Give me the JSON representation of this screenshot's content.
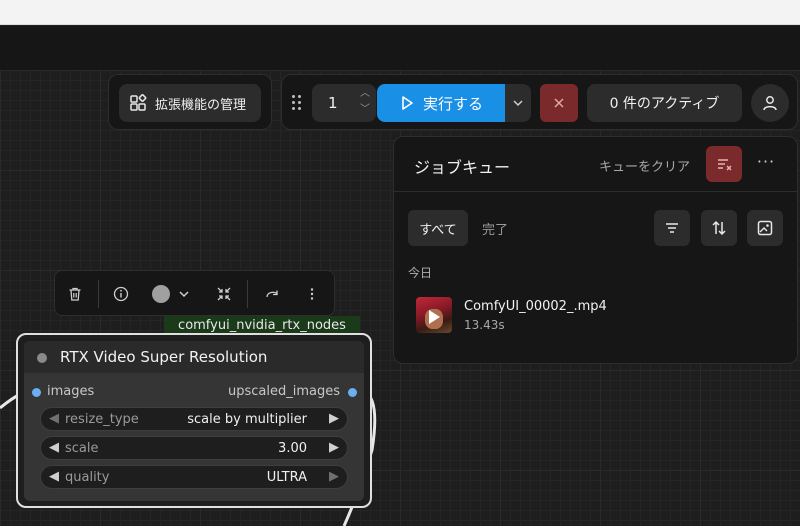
{
  "extensions": {
    "manage_label": "拡張機能の管理"
  },
  "run_bar": {
    "batch_count": "1",
    "run_label": "実行する",
    "active_label": "0 件のアクティブ"
  },
  "job_queue": {
    "title": "ジョブキュー",
    "clear_label": "キューをクリア",
    "more": "···",
    "tabs": {
      "all": "すべて",
      "completed": "完了"
    },
    "group_label": "今日",
    "items": [
      {
        "name": "ComfyUI_00002_.mp4",
        "duration": "13.43s"
      }
    ]
  },
  "node": {
    "group_label": "comfyui_nvidia_rtx_nodes",
    "title": "RTX Video Super Resolution",
    "input_label": "images",
    "output_label": "upscaled_images",
    "widgets": [
      {
        "label": "resize_type",
        "value": "scale by multiplier"
      },
      {
        "label": "scale",
        "value": "3.00"
      },
      {
        "label": "quality",
        "value": "ULTRA"
      }
    ]
  },
  "colors": {
    "accent": "#1a8fe6",
    "danger": "#7a2a2a",
    "slot": "#6ab0f0"
  }
}
